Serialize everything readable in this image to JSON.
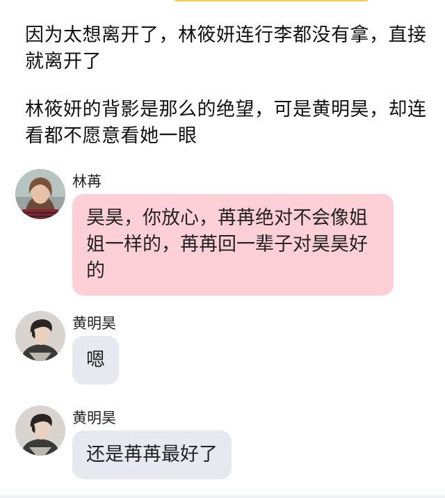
{
  "narration": [
    "因为太想离开了，林筱妍连行李都没有拿，直接就离开了",
    "林筱妍的背影是那么的绝望，可是黄明昊，却连看都不愿意看她一眼"
  ],
  "messages": [
    {
      "sender": "林苒",
      "text": "昊昊，你放心，苒苒绝对不会像姐姐一样的，苒苒回一辈子对昊昊好的",
      "bubble_color": "#fdd0d8",
      "avatar": "girl-avatar"
    },
    {
      "sender": "黄明昊",
      "text": "嗯",
      "bubble_color": "#e6e9f0",
      "avatar": "boy-avatar"
    },
    {
      "sender": "黄明昊",
      "text": "还是苒苒最好了",
      "bubble_color": "#e6e9f0",
      "avatar": "boy-avatar"
    }
  ]
}
